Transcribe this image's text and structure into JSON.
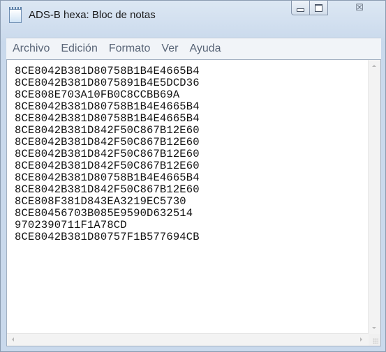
{
  "window": {
    "title": "ADS-B hexa: Bloc de notas",
    "icon": "notepad-icon",
    "caption_buttons": {
      "minimize_icon": "minimize-icon",
      "maximize_icon": "maximize-icon",
      "close_icon": "close-icon",
      "close_glyph": "☒"
    }
  },
  "menu": {
    "items": [
      "Archivo",
      "Edición",
      "Formato",
      "Ver",
      "Ayuda"
    ]
  },
  "editor": {
    "lines": [
      "8CE8042B381D80758B1B4E4665B4",
      "8CE8042B381D8075891B4E5DCD36",
      "8CE808E703A10FB0C8CCBB69A",
      "8CE8042B381D80758B1B4E4665B4",
      "8CE8042B381D80758B1B4E4665B4",
      "8CE8042B381D842F50C867B12E60",
      "8CE8042B381D842F50C867B12E60",
      "8CE8042B381D842F50C867B12E60",
      "8CE8042B381D842F50C867B12E60",
      "8CE8042B381D80758B1B4E4665B4",
      "8CE8042B381D842F50C867B12E60",
      "8CE808F381D843EA3219EC5730",
      "8CE80456703B085E9590D632514",
      "9702390711F1A78CD",
      "8CE8042B381D80757F1B577694CB"
    ]
  },
  "colors": {
    "title_bar": "#dce7f3",
    "menu_text": "#5a6678",
    "editor_bg": "#ffffff"
  }
}
